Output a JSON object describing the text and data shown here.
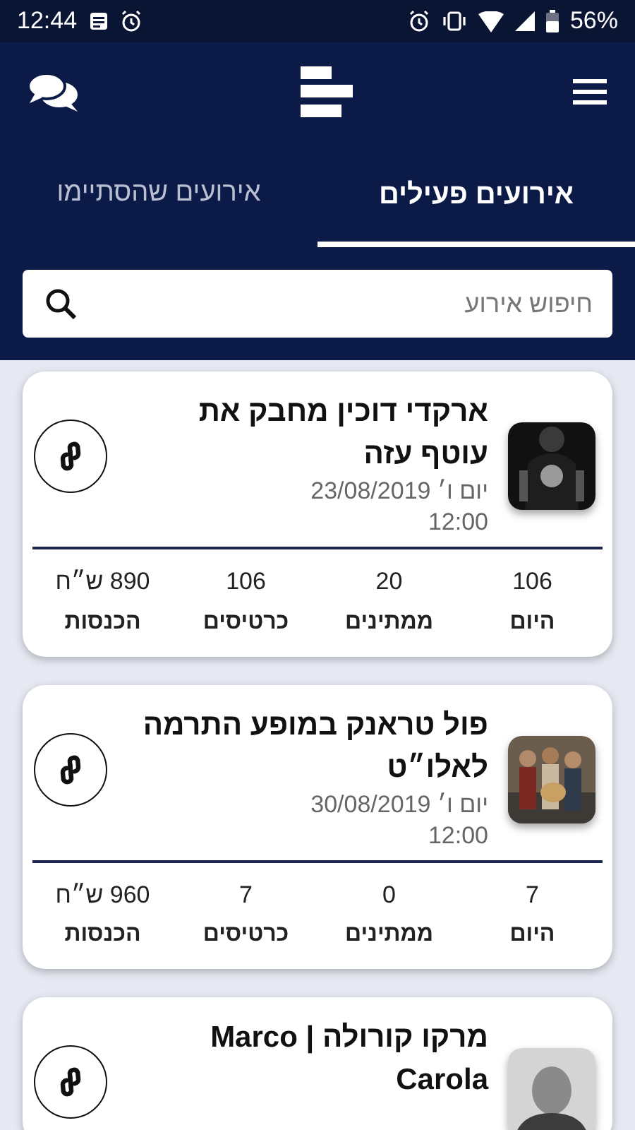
{
  "status_bar": {
    "time": "12:44",
    "battery": "56%"
  },
  "tabs": [
    {
      "label": "אירועים פעילים",
      "selected": true
    },
    {
      "label": "אירועים שהסתיימו",
      "selected": false
    }
  ],
  "search": {
    "placeholder": "חיפוש אירוע"
  },
  "events": [
    {
      "title": "ארקדי דוכין מחבק את עוטף עזה",
      "date": "יום ו׳ 23/08/2019",
      "time": "12:00",
      "stats": [
        {
          "value": "106",
          "label": "היום"
        },
        {
          "value": "20",
          "label": "ממתינים"
        },
        {
          "value": "106",
          "label": "כרטיסים"
        },
        {
          "value": "890 ש״ח",
          "label": "הכנסות"
        }
      ]
    },
    {
      "title": "פול טראנק במופע התרמה לאלו״ט",
      "date": "יום ו׳ 30/08/2019",
      "time": "12:00",
      "stats": [
        {
          "value": "7",
          "label": "היום"
        },
        {
          "value": "0",
          "label": "ממתינים"
        },
        {
          "value": "7",
          "label": "כרטיסים"
        },
        {
          "value": "960 ש״ח",
          "label": "הכנסות"
        }
      ]
    },
    {
      "title": "מרקו קורולה | Marco Carola"
    }
  ]
}
